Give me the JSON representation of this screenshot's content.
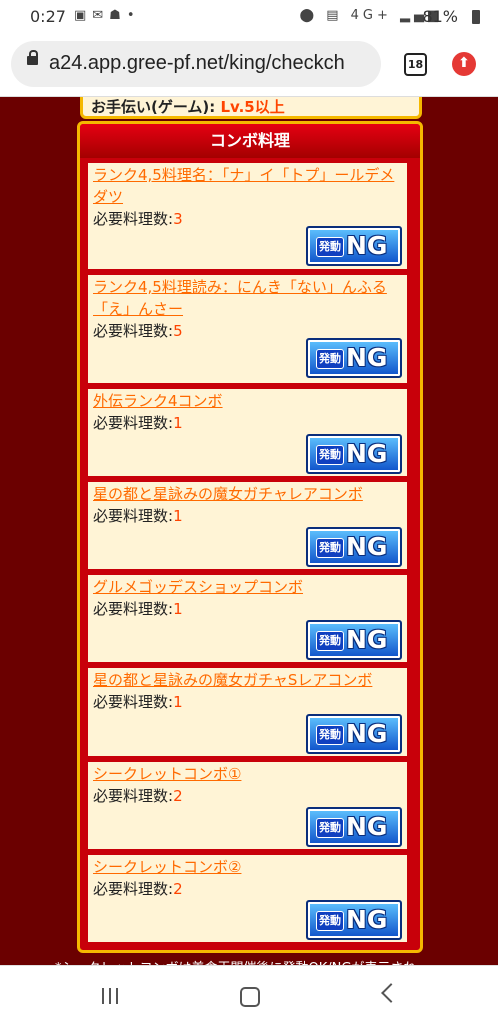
{
  "status_bar": {
    "time": "0:27",
    "network": "4G+",
    "battery": "81%"
  },
  "browser": {
    "url": "a24.app.gree-pf.net/king/checkch",
    "tab_count": "18"
  },
  "prev_section": {
    "label": "お手伝い(ゲーム):",
    "value": "Lv.5以上"
  },
  "panel": {
    "title": "コンボ料理",
    "button_hatsudo": "発動",
    "button_ng": "NG",
    "combos": [
      {
        "name": "ランク4,5料理名：「ナ」イ「トプ」ールデメダツ",
        "req_label": "必要料理数:",
        "req_count": "3"
      },
      {
        "name": "ランク4,5料理読み：にんき「ない」んふる「え」んさー",
        "req_label": "必要料理数:",
        "req_count": "5"
      },
      {
        "name": "外伝ランク4コンボ",
        "req_label": "必要料理数:",
        "req_count": "1"
      },
      {
        "name": "星の都と星詠みの魔女ガチャレアコンボ",
        "req_label": "必要料理数:",
        "req_count": "1"
      },
      {
        "name": "グルメゴッデスショップコンボ",
        "req_label": "必要料理数:",
        "req_count": "1"
      },
      {
        "name": "星の都と星詠みの魔女ガチャSレアコンボ",
        "req_label": "必要料理数:",
        "req_count": "1"
      },
      {
        "name": "シークレットコンボ①",
        "req_label": "必要料理数:",
        "req_count": "2"
      },
      {
        "name": "シークレットコンボ②",
        "req_label": "必要料理数:",
        "req_count": "2"
      }
    ]
  },
  "footnote": "*シークレットコンボは美食王開催後に発動OK/NGが表示され"
}
